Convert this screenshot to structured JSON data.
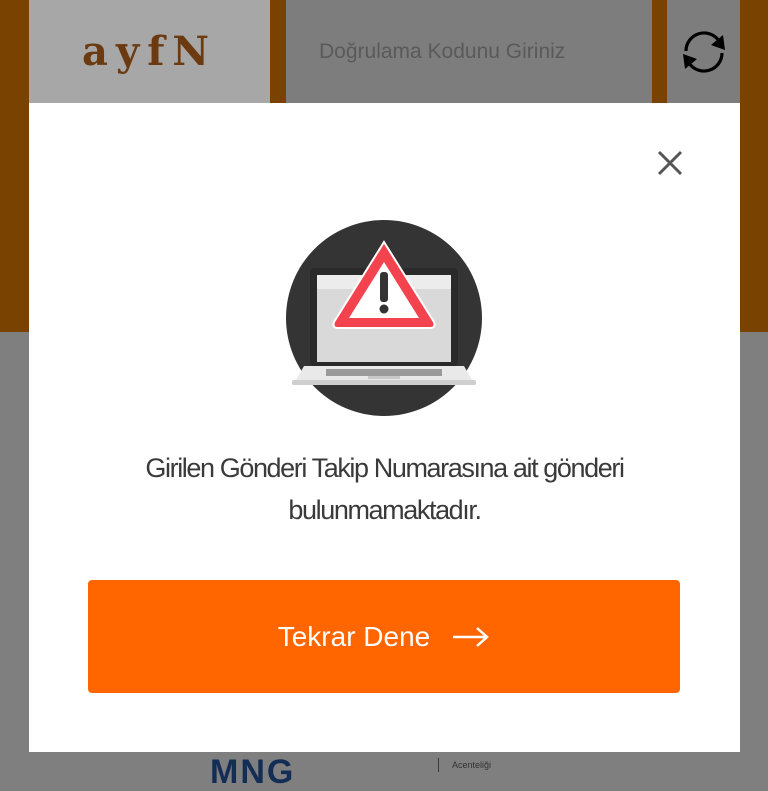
{
  "background": {
    "captcha_text": "ayfN",
    "code_input": {
      "placeholder": "Doğrulama Kodunu Giriniz",
      "value": ""
    },
    "footer_logo_text": "MNG",
    "footer_text": "Acenteliği"
  },
  "modal": {
    "message": "Girilen Gönderi Takip Numarasına ait gönderi bulunmamaktadır.",
    "retry_button_label": "Tekrar Dene"
  },
  "icons": {
    "close": "close-icon",
    "refresh": "refresh-icon",
    "warning": "warning-laptop-illustration",
    "arrow": "arrow-right-icon"
  },
  "colors": {
    "accent": "#ff6600",
    "overlay_orange": "#7a4200",
    "modal_bg": "#ffffff"
  }
}
